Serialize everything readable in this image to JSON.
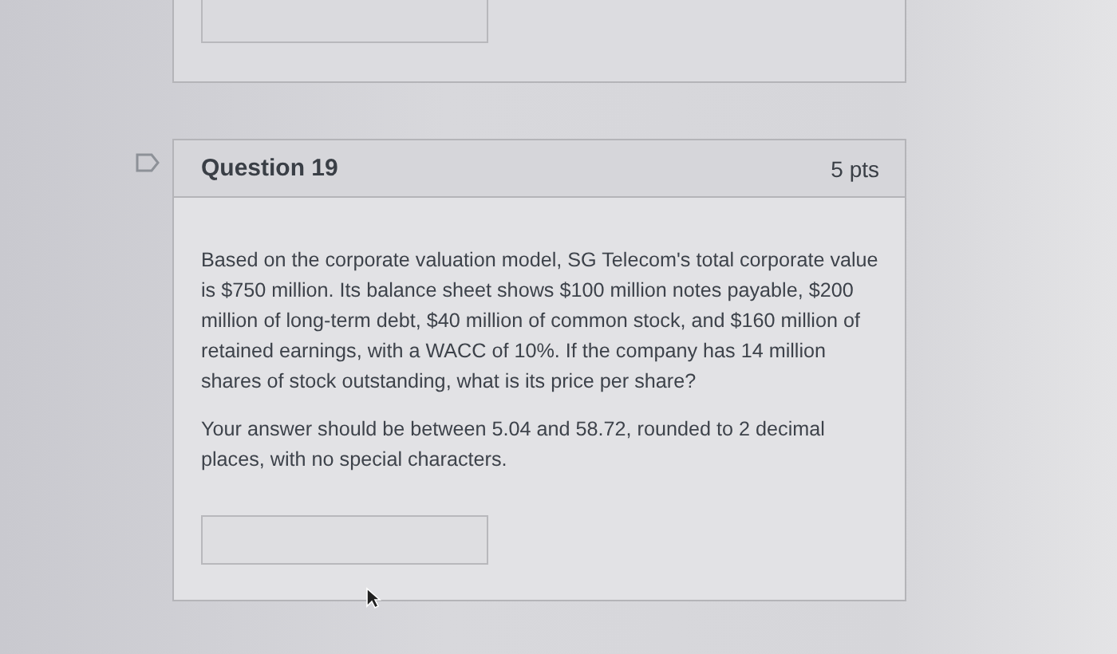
{
  "question": {
    "title": "Question 19",
    "points": "5 pts",
    "flagged": false,
    "paragraphs": [
      "Based on the corporate valuation model, SG Telecom's total corporate value is $750 million. Its balance sheet shows $100 million notes payable, $200 million of long-term debt, $40 million of common stock, and $160 million of retained earnings, with a WACC of 10%. If the company has 14 million shares of stock outstanding, what is its price per share?",
      "Your answer should be between 5.04 and 58.72, rounded to 2 decimal places, with no special characters."
    ]
  }
}
